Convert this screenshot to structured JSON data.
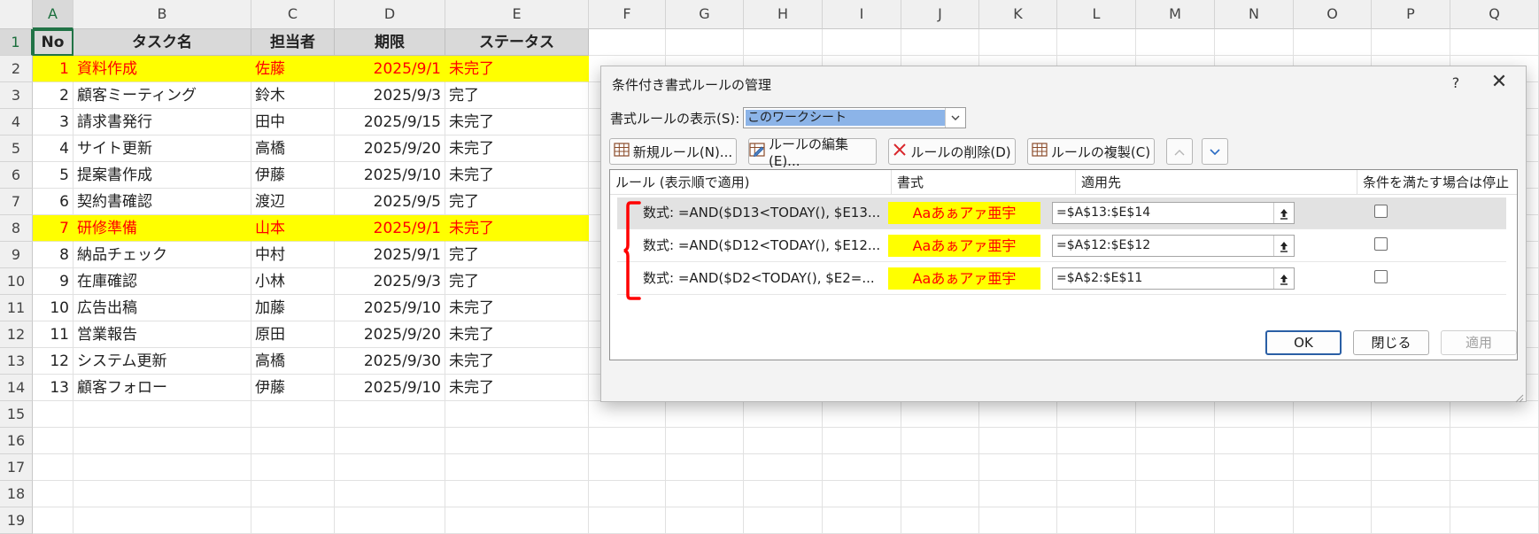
{
  "sheet": {
    "columns": [
      "A",
      "B",
      "C",
      "D",
      "E",
      "F",
      "G",
      "H",
      "I",
      "J",
      "K",
      "L",
      "M",
      "N",
      "O",
      "P",
      "Q"
    ],
    "rows": [
      "1",
      "2",
      "3",
      "4",
      "5",
      "6",
      "7",
      "8",
      "9",
      "10",
      "11",
      "12",
      "13",
      "14",
      "15",
      "16",
      "17",
      "18",
      "19"
    ],
    "headers": {
      "no": "No",
      "task": "タスク名",
      "owner": "担当者",
      "due": "期限",
      "status": "ステータス"
    },
    "data": [
      {
        "no": "1",
        "task": "資料作成",
        "owner": "佐藤",
        "due": "2025/9/1",
        "status": "未完了",
        "highlight": true
      },
      {
        "no": "2",
        "task": "顧客ミーティング",
        "owner": "鈴木",
        "due": "2025/9/3",
        "status": "完了",
        "highlight": false
      },
      {
        "no": "3",
        "task": "請求書発行",
        "owner": "田中",
        "due": "2025/9/15",
        "status": "未完了",
        "highlight": false
      },
      {
        "no": "4",
        "task": "サイト更新",
        "owner": "高橋",
        "due": "2025/9/20",
        "status": "未完了",
        "highlight": false
      },
      {
        "no": "5",
        "task": "提案書作成",
        "owner": "伊藤",
        "due": "2025/9/10",
        "status": "未完了",
        "highlight": false
      },
      {
        "no": "6",
        "task": "契約書確認",
        "owner": "渡辺",
        "due": "2025/9/5",
        "status": "完了",
        "highlight": false
      },
      {
        "no": "7",
        "task": "研修準備",
        "owner": "山本",
        "due": "2025/9/1",
        "status": "未完了",
        "highlight": true
      },
      {
        "no": "8",
        "task": "納品チェック",
        "owner": "中村",
        "due": "2025/9/1",
        "status": "完了",
        "highlight": false
      },
      {
        "no": "9",
        "task": "在庫確認",
        "owner": "小林",
        "due": "2025/9/3",
        "status": "完了",
        "highlight": false
      },
      {
        "no": "10",
        "task": "広告出稿",
        "owner": "加藤",
        "due": "2025/9/10",
        "status": "未完了",
        "highlight": false
      },
      {
        "no": "11",
        "task": "営業報告",
        "owner": "原田",
        "due": "2025/9/20",
        "status": "未完了",
        "highlight": false
      },
      {
        "no": "12",
        "task": "システム更新",
        "owner": "高橋",
        "due": "2025/9/30",
        "status": "未完了",
        "highlight": false
      },
      {
        "no": "13",
        "task": "顧客フォロー",
        "owner": "伊藤",
        "due": "2025/9/10",
        "status": "未完了",
        "highlight": false
      }
    ],
    "colors": {
      "highlight_fill": "#ffff00",
      "highlight_text": "#ff0000",
      "accent": "#217346"
    }
  },
  "dialog": {
    "title": "条件付き書式ルールの管理",
    "help": "?",
    "close": "✕",
    "show_label": "書式ルールの表示(S):",
    "show_value": "このワークシート",
    "buttons": {
      "new_rule": "新規ルール(N)...",
      "edit_rule": "ルールの編集(E)...",
      "delete_rule": "ルールの削除(D)",
      "duplicate_rule": "ルールの複製(C)"
    },
    "columns": {
      "rule": "ルール (表示順で適用)",
      "format": "書式",
      "applies_to": "適用先",
      "stop": "条件を満たす場合は停止"
    },
    "rules": [
      {
        "formula": "数式: =AND($D13<TODAY(), $E13...",
        "preview": "Aaあぁアァ亜宇",
        "applies_to": "=$A$13:$E$14",
        "stop": false,
        "selected": true
      },
      {
        "formula": "数式: =AND($D12<TODAY(), $E12...",
        "preview": "Aaあぁアァ亜宇",
        "applies_to": "=$A$12:$E$12",
        "stop": false,
        "selected": false
      },
      {
        "formula": "数式: =AND($D2<TODAY(), $E2=...",
        "preview": "Aaあぁアァ亜宇",
        "applies_to": "=$A$2:$E$11",
        "stop": false,
        "selected": false
      }
    ],
    "footer": {
      "ok": "OK",
      "close": "閉じる",
      "apply": "適用"
    },
    "annotation_color": "#ff0000"
  }
}
